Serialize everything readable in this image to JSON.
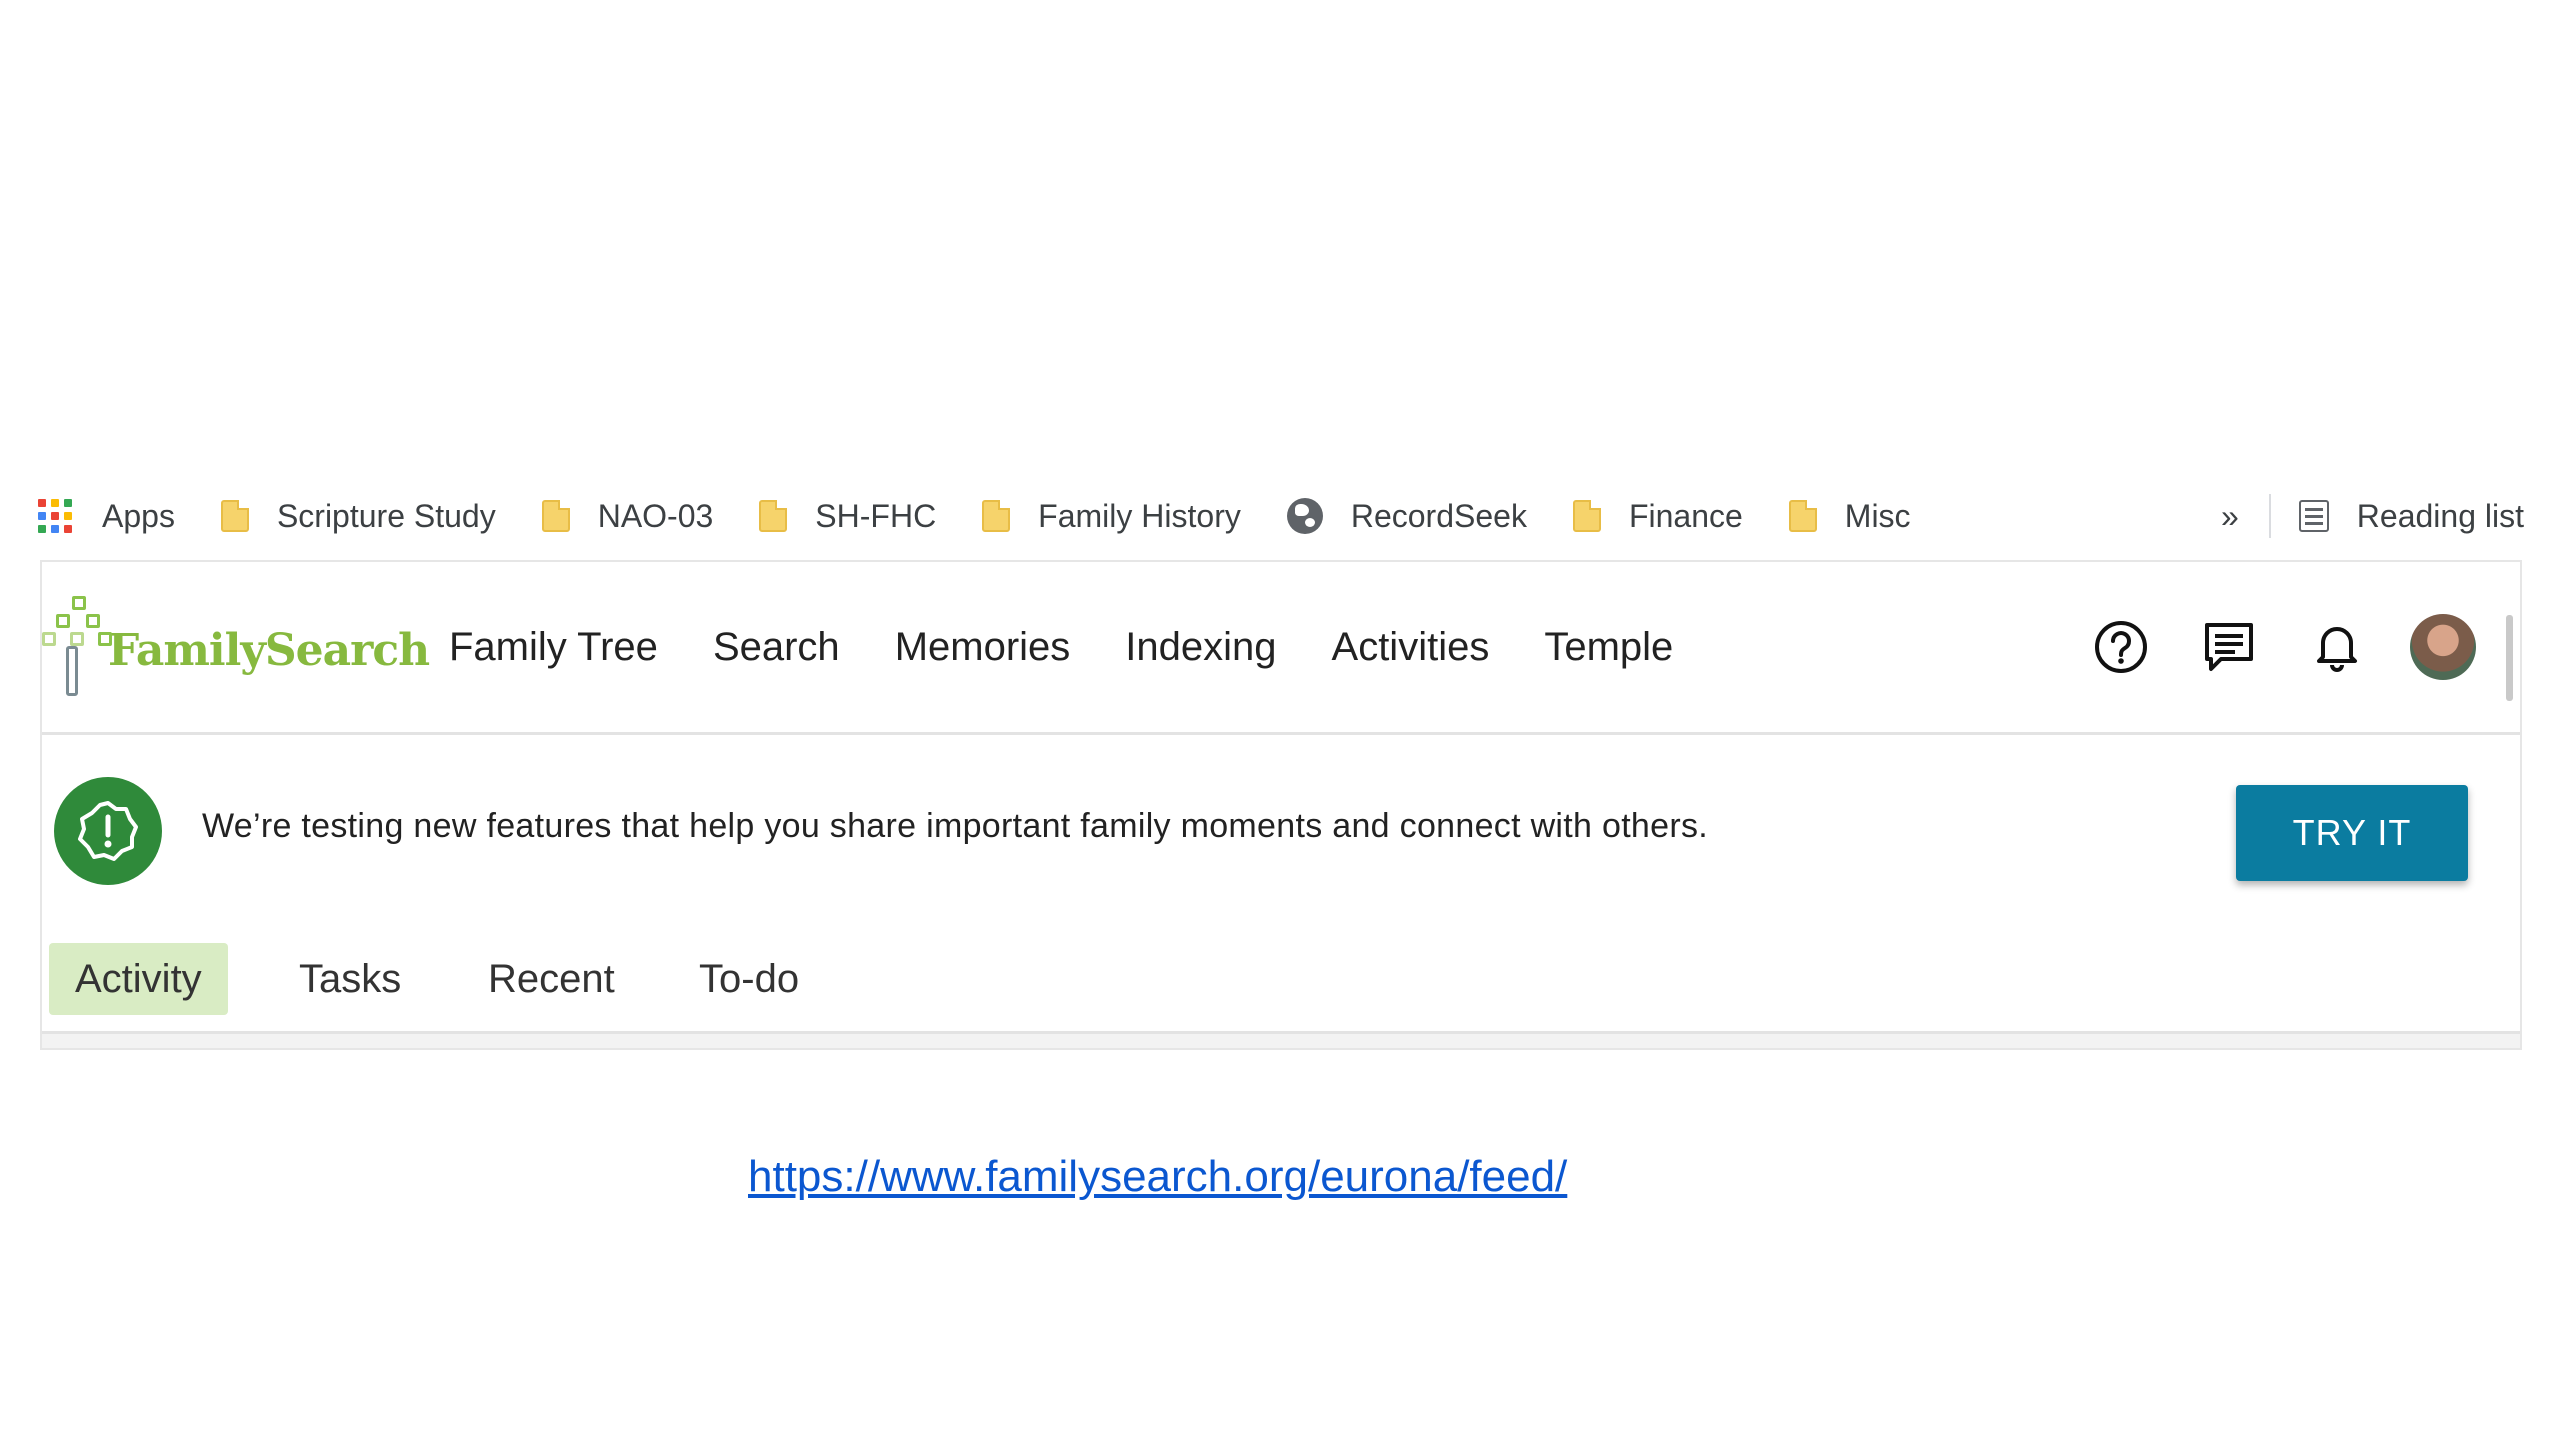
{
  "bookmarks": {
    "items": [
      {
        "label": "Apps",
        "icon": "apps-grid-icon"
      },
      {
        "label": "Scripture Study",
        "icon": "folder-icon"
      },
      {
        "label": "NAO-03",
        "icon": "folder-icon"
      },
      {
        "label": "SH-FHC",
        "icon": "folder-icon"
      },
      {
        "label": "Family History",
        "icon": "folder-icon"
      },
      {
        "label": "RecordSeek",
        "icon": "globe-icon"
      },
      {
        "label": "Finance",
        "icon": "folder-icon"
      },
      {
        "label": "Misc",
        "icon": "folder-icon"
      }
    ],
    "overflow": "»",
    "reading_list": "Reading list"
  },
  "header": {
    "logo_text": "FamilySearch",
    "nav": [
      "Family Tree",
      "Search",
      "Memories",
      "Indexing",
      "Activities",
      "Temple"
    ],
    "icons": [
      "help-icon",
      "chat-icon",
      "bell-icon",
      "avatar"
    ]
  },
  "banner": {
    "message": "We’re testing new features that help you share important family moments and connect with others.",
    "button": "TRY IT"
  },
  "tabs": [
    "Activity",
    "Tasks",
    "Recent",
    "To-do"
  ],
  "url": "https://www.familysearch.org/eurona/feed/",
  "colors": {
    "brand_green": "#87b93f",
    "badge_green": "#2f8a3a",
    "button_blue": "#0b7ca0",
    "active_tab": "#d9ecc4",
    "link": "#0b57d0"
  }
}
